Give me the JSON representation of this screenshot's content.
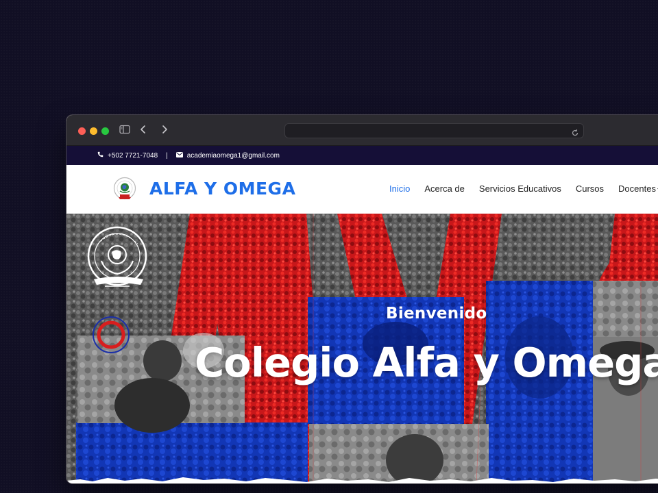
{
  "browser": {
    "url": ""
  },
  "topbar": {
    "phone": "+502 7721-7048",
    "separator": "|",
    "email": "academiaomega1@gmail.com"
  },
  "navbar": {
    "brand": "ALFA Y OMEGA",
    "links": [
      {
        "label": "Inicio",
        "active": true
      },
      {
        "label": "Acerca de",
        "active": false
      },
      {
        "label": "Servicios Educativos",
        "active": false
      },
      {
        "label": "Cursos",
        "active": false
      },
      {
        "label": "Docentes",
        "active": false,
        "dropdown": true
      }
    ]
  },
  "hero": {
    "subtitle": "Bienvenido",
    "title": "Colegio Alfa y Omega",
    "emblem_text": "COLEGIO ALFA Y OMEGA"
  },
  "colors": {
    "page_bg": "#110f24",
    "topbar_bg": "#150f37",
    "brand_blue": "#1e6ee8",
    "hero_red": "#d81e1e",
    "hero_blue": "#1233b8"
  },
  "icons": [
    "sidebar-toggle-icon",
    "back-arrow-icon",
    "forward-arrow-icon",
    "reload-icon",
    "phone-icon",
    "mail-icon",
    "caret-down-icon"
  ]
}
